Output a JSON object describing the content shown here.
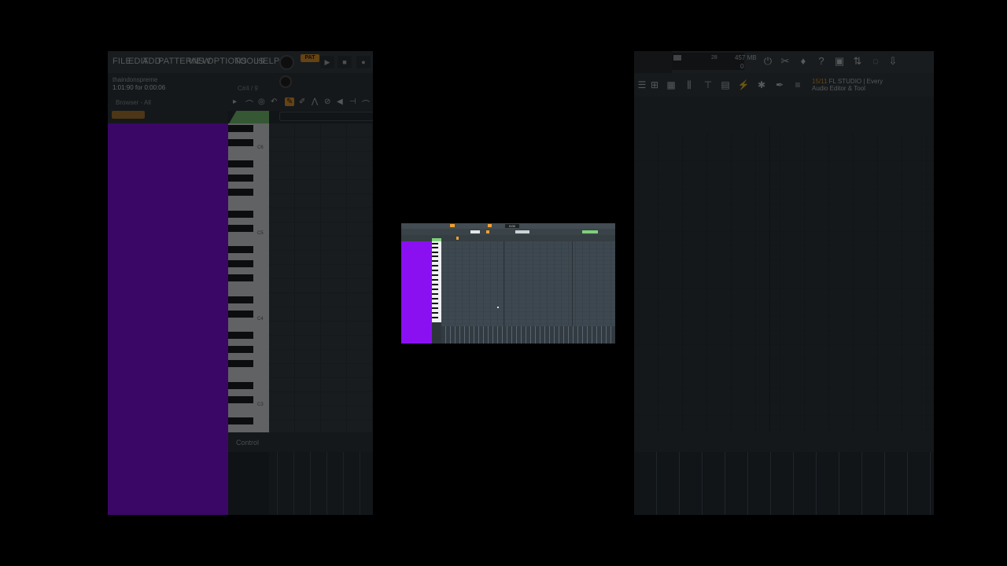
{
  "menu": [
    "FILE",
    "EDIT",
    "ADD",
    "PATTERNS",
    "VIEW",
    "OPTIONS",
    "TOOLS",
    "HELP"
  ],
  "pattern_label": "PAT",
  "hint": {
    "line1": "thaindonspreme",
    "line2": "1:01:90 for 0:00:06",
    "note": "C#4 / 9"
  },
  "browser": {
    "label": "Browser - All"
  },
  "control": {
    "label": "Control"
  },
  "key_labels": [
    "C6",
    "C5",
    "C4",
    "C3"
  ],
  "transport": {
    "play": "▶",
    "stop": "■",
    "record": "●"
  },
  "center": {
    "lcd": "0:00"
  },
  "perf": {
    "cpu": "28",
    "mem": "457 MB",
    "poly": "0"
  },
  "news": {
    "counter": "15/11",
    "title": "FL STUDIO | Every",
    "subtitle": "Audio Editor & Tool"
  },
  "colors": {
    "accent": "#f0a030",
    "browser": "#8a10f2",
    "keys_green": "#7fd07a"
  }
}
